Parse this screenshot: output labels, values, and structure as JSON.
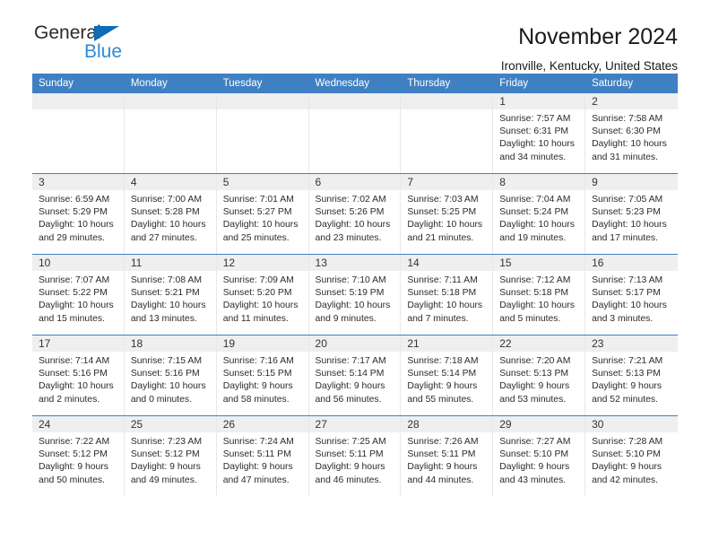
{
  "brand": {
    "name_top": "General",
    "name_bottom": "Blue",
    "triangle_color": "#0f6cb6",
    "blue_text_color": "#2e8ad6"
  },
  "header": {
    "title": "November 2024",
    "subtitle": "Ironville, Kentucky, United States",
    "accent_color": "#3f80c2",
    "band_color": "#efefef"
  },
  "weekdays": [
    "Sunday",
    "Monday",
    "Tuesday",
    "Wednesday",
    "Thursday",
    "Friday",
    "Saturday"
  ],
  "labels": {
    "sunrise": "Sunrise:",
    "sunset": "Sunset:",
    "daylight": "Daylight:"
  },
  "weeks": [
    [
      {
        "day": "",
        "sunrise": "",
        "sunset": "",
        "daylight_1": "",
        "daylight_2": "",
        "empty": true
      },
      {
        "day": "",
        "sunrise": "",
        "sunset": "",
        "daylight_1": "",
        "daylight_2": "",
        "empty": true
      },
      {
        "day": "",
        "sunrise": "",
        "sunset": "",
        "daylight_1": "",
        "daylight_2": "",
        "empty": true
      },
      {
        "day": "",
        "sunrise": "",
        "sunset": "",
        "daylight_1": "",
        "daylight_2": "",
        "empty": true
      },
      {
        "day": "",
        "sunrise": "",
        "sunset": "",
        "daylight_1": "",
        "daylight_2": "",
        "empty": true
      },
      {
        "day": "1",
        "sunrise": "Sunrise: 7:57 AM",
        "sunset": "Sunset: 6:31 PM",
        "daylight_1": "Daylight: 10 hours",
        "daylight_2": "and 34 minutes."
      },
      {
        "day": "2",
        "sunrise": "Sunrise: 7:58 AM",
        "sunset": "Sunset: 6:30 PM",
        "daylight_1": "Daylight: 10 hours",
        "daylight_2": "and 31 minutes."
      }
    ],
    [
      {
        "day": "3",
        "sunrise": "Sunrise: 6:59 AM",
        "sunset": "Sunset: 5:29 PM",
        "daylight_1": "Daylight: 10 hours",
        "daylight_2": "and 29 minutes."
      },
      {
        "day": "4",
        "sunrise": "Sunrise: 7:00 AM",
        "sunset": "Sunset: 5:28 PM",
        "daylight_1": "Daylight: 10 hours",
        "daylight_2": "and 27 minutes."
      },
      {
        "day": "5",
        "sunrise": "Sunrise: 7:01 AM",
        "sunset": "Sunset: 5:27 PM",
        "daylight_1": "Daylight: 10 hours",
        "daylight_2": "and 25 minutes."
      },
      {
        "day": "6",
        "sunrise": "Sunrise: 7:02 AM",
        "sunset": "Sunset: 5:26 PM",
        "daylight_1": "Daylight: 10 hours",
        "daylight_2": "and 23 minutes."
      },
      {
        "day": "7",
        "sunrise": "Sunrise: 7:03 AM",
        "sunset": "Sunset: 5:25 PM",
        "daylight_1": "Daylight: 10 hours",
        "daylight_2": "and 21 minutes."
      },
      {
        "day": "8",
        "sunrise": "Sunrise: 7:04 AM",
        "sunset": "Sunset: 5:24 PM",
        "daylight_1": "Daylight: 10 hours",
        "daylight_2": "and 19 minutes."
      },
      {
        "day": "9",
        "sunrise": "Sunrise: 7:05 AM",
        "sunset": "Sunset: 5:23 PM",
        "daylight_1": "Daylight: 10 hours",
        "daylight_2": "and 17 minutes."
      }
    ],
    [
      {
        "day": "10",
        "sunrise": "Sunrise: 7:07 AM",
        "sunset": "Sunset: 5:22 PM",
        "daylight_1": "Daylight: 10 hours",
        "daylight_2": "and 15 minutes."
      },
      {
        "day": "11",
        "sunrise": "Sunrise: 7:08 AM",
        "sunset": "Sunset: 5:21 PM",
        "daylight_1": "Daylight: 10 hours",
        "daylight_2": "and 13 minutes."
      },
      {
        "day": "12",
        "sunrise": "Sunrise: 7:09 AM",
        "sunset": "Sunset: 5:20 PM",
        "daylight_1": "Daylight: 10 hours",
        "daylight_2": "and 11 minutes."
      },
      {
        "day": "13",
        "sunrise": "Sunrise: 7:10 AM",
        "sunset": "Sunset: 5:19 PM",
        "daylight_1": "Daylight: 10 hours",
        "daylight_2": "and 9 minutes."
      },
      {
        "day": "14",
        "sunrise": "Sunrise: 7:11 AM",
        "sunset": "Sunset: 5:18 PM",
        "daylight_1": "Daylight: 10 hours",
        "daylight_2": "and 7 minutes."
      },
      {
        "day": "15",
        "sunrise": "Sunrise: 7:12 AM",
        "sunset": "Sunset: 5:18 PM",
        "daylight_1": "Daylight: 10 hours",
        "daylight_2": "and 5 minutes."
      },
      {
        "day": "16",
        "sunrise": "Sunrise: 7:13 AM",
        "sunset": "Sunset: 5:17 PM",
        "daylight_1": "Daylight: 10 hours",
        "daylight_2": "and 3 minutes."
      }
    ],
    [
      {
        "day": "17",
        "sunrise": "Sunrise: 7:14 AM",
        "sunset": "Sunset: 5:16 PM",
        "daylight_1": "Daylight: 10 hours",
        "daylight_2": "and 2 minutes."
      },
      {
        "day": "18",
        "sunrise": "Sunrise: 7:15 AM",
        "sunset": "Sunset: 5:16 PM",
        "daylight_1": "Daylight: 10 hours",
        "daylight_2": "and 0 minutes."
      },
      {
        "day": "19",
        "sunrise": "Sunrise: 7:16 AM",
        "sunset": "Sunset: 5:15 PM",
        "daylight_1": "Daylight: 9 hours",
        "daylight_2": "and 58 minutes."
      },
      {
        "day": "20",
        "sunrise": "Sunrise: 7:17 AM",
        "sunset": "Sunset: 5:14 PM",
        "daylight_1": "Daylight: 9 hours",
        "daylight_2": "and 56 minutes."
      },
      {
        "day": "21",
        "sunrise": "Sunrise: 7:18 AM",
        "sunset": "Sunset: 5:14 PM",
        "daylight_1": "Daylight: 9 hours",
        "daylight_2": "and 55 minutes."
      },
      {
        "day": "22",
        "sunrise": "Sunrise: 7:20 AM",
        "sunset": "Sunset: 5:13 PM",
        "daylight_1": "Daylight: 9 hours",
        "daylight_2": "and 53 minutes."
      },
      {
        "day": "23",
        "sunrise": "Sunrise: 7:21 AM",
        "sunset": "Sunset: 5:13 PM",
        "daylight_1": "Daylight: 9 hours",
        "daylight_2": "and 52 minutes."
      }
    ],
    [
      {
        "day": "24",
        "sunrise": "Sunrise: 7:22 AM",
        "sunset": "Sunset: 5:12 PM",
        "daylight_1": "Daylight: 9 hours",
        "daylight_2": "and 50 minutes."
      },
      {
        "day": "25",
        "sunrise": "Sunrise: 7:23 AM",
        "sunset": "Sunset: 5:12 PM",
        "daylight_1": "Daylight: 9 hours",
        "daylight_2": "and 49 minutes."
      },
      {
        "day": "26",
        "sunrise": "Sunrise: 7:24 AM",
        "sunset": "Sunset: 5:11 PM",
        "daylight_1": "Daylight: 9 hours",
        "daylight_2": "and 47 minutes."
      },
      {
        "day": "27",
        "sunrise": "Sunrise: 7:25 AM",
        "sunset": "Sunset: 5:11 PM",
        "daylight_1": "Daylight: 9 hours",
        "daylight_2": "and 46 minutes."
      },
      {
        "day": "28",
        "sunrise": "Sunrise: 7:26 AM",
        "sunset": "Sunset: 5:11 PM",
        "daylight_1": "Daylight: 9 hours",
        "daylight_2": "and 44 minutes."
      },
      {
        "day": "29",
        "sunrise": "Sunrise: 7:27 AM",
        "sunset": "Sunset: 5:10 PM",
        "daylight_1": "Daylight: 9 hours",
        "daylight_2": "and 43 minutes."
      },
      {
        "day": "30",
        "sunrise": "Sunrise: 7:28 AM",
        "sunset": "Sunset: 5:10 PM",
        "daylight_1": "Daylight: 9 hours",
        "daylight_2": "and 42 minutes."
      }
    ]
  ]
}
